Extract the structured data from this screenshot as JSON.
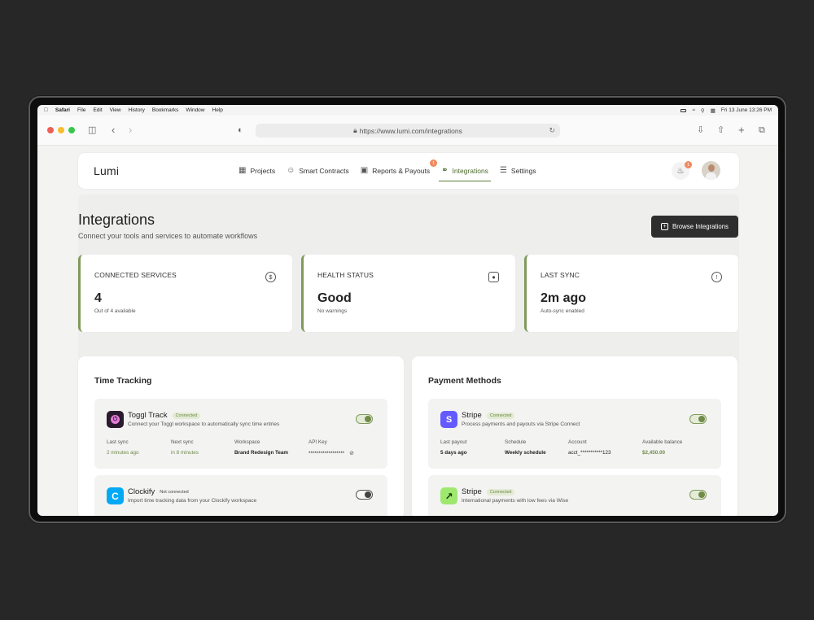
{
  "menubar": {
    "app": "Safari",
    "items": [
      "File",
      "Edit",
      "View",
      "History",
      "Bookmarks",
      "Window",
      "Help"
    ],
    "clock": "Fri 13 June  13:26 PM"
  },
  "browser": {
    "url": "https://www.lumi.com/integrations",
    "lights": [
      "#ee5f57",
      "#f7bd2f",
      "#36c84b"
    ]
  },
  "nav": {
    "logo": "Lumi",
    "items": [
      {
        "label": "Projects",
        "icon": "grid-icon"
      },
      {
        "label": "Smart Contracts",
        "icon": "users-icon"
      },
      {
        "label": "Reports & Payouts",
        "icon": "wallet-icon",
        "badge": "1"
      },
      {
        "label": "Integrations",
        "icon": "link-icon",
        "active": true
      },
      {
        "label": "Settings",
        "icon": "sliders-icon"
      }
    ],
    "notifications_badge": "1"
  },
  "header": {
    "title": "Integrations",
    "subtitle": "Connect your tools and services to automate workflows",
    "browse_button": "Browse Integrations"
  },
  "stats": [
    {
      "label": "CONNECTED SERVICES",
      "value": "4",
      "sub": "Out of 4 available",
      "icon": "dollar-icon"
    },
    {
      "label": "HEALTH STATUS",
      "value": "Good",
      "sub": "No warnings",
      "icon": "wallet-icon"
    },
    {
      "label": "LAST SYNC",
      "value": "2m ago",
      "sub": "Auto-sync enabled",
      "icon": "alert-icon"
    }
  ],
  "time_tracking": {
    "title": "Time Tracking",
    "toggl": {
      "name": "Toggl Track",
      "status": "Connected",
      "desc": "Connect your Toggl workspace to automatically sync time entries",
      "meta": [
        {
          "k": "Last sync",
          "v": "2 minutes ago"
        },
        {
          "k": "Next sync",
          "v": "in 8 minutes"
        },
        {
          "k": "Workspace",
          "v": "Brand Redesign Team"
        },
        {
          "k": "API Key",
          "v": "******************"
        }
      ],
      "enabled": true
    },
    "clockify": {
      "name": "Clockify",
      "status": "Not connected",
      "desc": "Import time tracking data from your Clockify workspace",
      "enabled": false
    }
  },
  "payment_methods": {
    "title": "Payment Methods",
    "stripe": {
      "name": "Stripe",
      "status": "Connected",
      "desc": "Process payments and payouts via Stripe Connect",
      "meta": [
        {
          "k": "Last payout",
          "v": "5 days ago"
        },
        {
          "k": "Schedule",
          "v": "Weekly schedule"
        },
        {
          "k": "Account",
          "v": "acct_***********123"
        },
        {
          "k": "Available balance",
          "v": "$2,450.00"
        }
      ],
      "enabled": true
    },
    "wise": {
      "name": "Stripe",
      "status": "Connected",
      "desc": "International payments with low fees via Wise",
      "enabled": true
    }
  },
  "colors": {
    "accent": "#6f8a49",
    "dark_button": "#2e2e2e",
    "badge": "#f08a5d"
  }
}
